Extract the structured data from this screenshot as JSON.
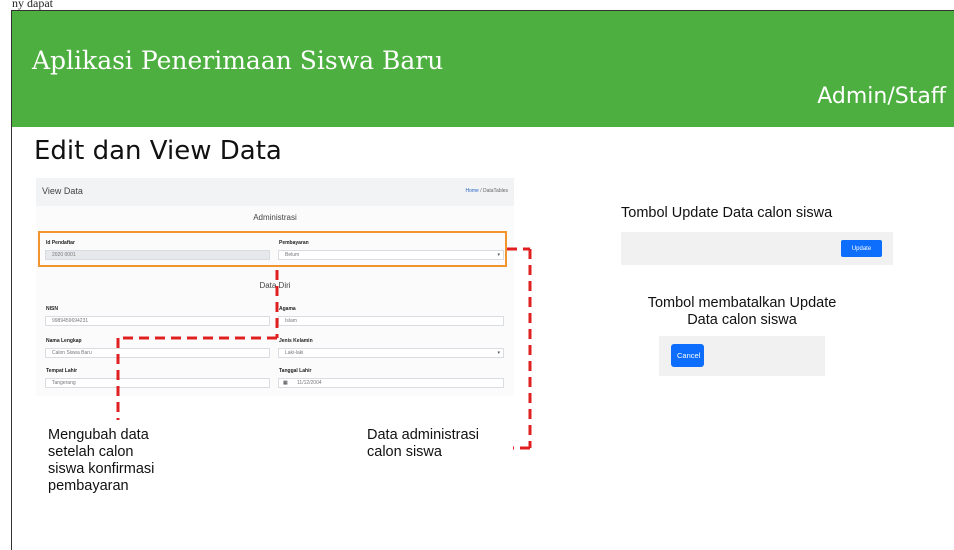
{
  "top_cut_text": "ny dapat",
  "header": {
    "app_title": "Aplikasi Penerimaan Siswa Baru",
    "role": "Admin/Staff"
  },
  "section_title": "Edit dan View Data",
  "screenshot": {
    "page_title": "View Data",
    "breadcrumb": {
      "home": "Home",
      "separator": " / ",
      "current": "DataTables"
    },
    "admin_section": "Administrasi",
    "id_label": "Id Pendaftar",
    "id_value": "2020 0001",
    "payment_label": "Pembayaran",
    "payment_value": "Belum",
    "personal_section": "Data Diri",
    "nisn_label": "NISN",
    "nisn_value": "9989459694231",
    "religion_label": "Agama",
    "religion_value": "Islam",
    "name_label": "Nama Lengkap",
    "name_value": "Calon Siswa Baru",
    "gender_label": "Jenis Kelamin",
    "gender_value": "Laki-laki",
    "birthplace_label": "Tempat Lahir",
    "birthplace_value": "Tangerang",
    "birthdate_label": "Tanggal Lahir",
    "birthdate_value": "11/12/2004"
  },
  "callouts": {
    "edit_note_lines": [
      "Mengubah data",
      "setelah calon",
      "siswa konfirmasi",
      "pembayaran"
    ],
    "admin_note_lines": [
      "Data administrasi",
      "calon siswa"
    ],
    "update_caption": "Tombol Update Data calon siswa",
    "cancel_caption_lines": [
      "Tombol membatalkan Update",
      "Data calon siswa"
    ]
  },
  "buttons": {
    "update": "Update",
    "cancel": "Cancel"
  },
  "colors": {
    "header_green": "#4caf3f",
    "highlight_orange": "#f2952e",
    "dash_red": "#e02020",
    "button_blue": "#0d6efd"
  }
}
